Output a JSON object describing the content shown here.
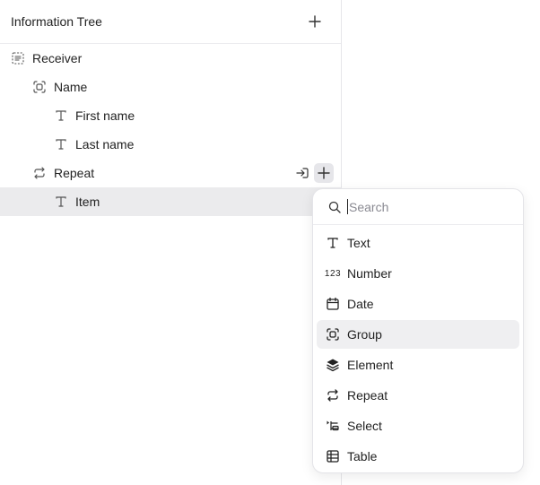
{
  "panel": {
    "title": "Information Tree",
    "add_icon": "plus-icon"
  },
  "tree": {
    "items": [
      {
        "label": "Receiver",
        "icon": "group-box-icon",
        "level": 0
      },
      {
        "label": "Name",
        "icon": "group-icon",
        "level": 1
      },
      {
        "label": "First name",
        "icon": "text-icon",
        "level": 2
      },
      {
        "label": "Last name",
        "icon": "text-icon",
        "level": 2
      },
      {
        "label": "Repeat",
        "icon": "repeat-icon",
        "level": 1
      },
      {
        "label": "Item",
        "icon": "text-icon",
        "level": 2,
        "selected": true
      }
    ],
    "row_actions": [
      "insert-icon",
      "plus-icon"
    ]
  },
  "popup": {
    "search": {
      "placeholder": "Search",
      "value": ""
    },
    "items": [
      {
        "label": "Text",
        "icon": "text-icon"
      },
      {
        "label": "Number",
        "icon": "number-icon",
        "glyph": "123"
      },
      {
        "label": "Date",
        "icon": "calendar-icon"
      },
      {
        "label": "Group",
        "icon": "group-icon",
        "hovered": true
      },
      {
        "label": "Element",
        "icon": "layers-icon"
      },
      {
        "label": "Repeat",
        "icon": "repeat-icon"
      },
      {
        "label": "Select",
        "icon": "select-icon"
      },
      {
        "label": "Table",
        "icon": "table-icon"
      }
    ]
  },
  "colors": {
    "selected_row": "#ebebed",
    "hover_item": "#efeff1",
    "border": "#e6e6ea"
  }
}
